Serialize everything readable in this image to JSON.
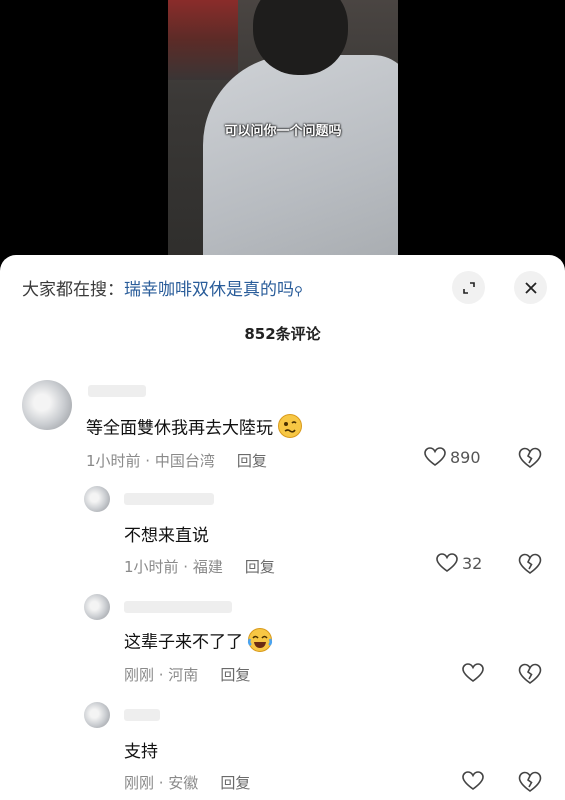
{
  "video": {
    "subtitle": "可以问你一个问题吗"
  },
  "search": {
    "prefix": "大家都在搜：",
    "query": "瑞幸咖啡双休是真的吗"
  },
  "comments_count": "852条评论",
  "comments": [
    {
      "text": "等全面雙休我再去大陸玩",
      "time_location": "1小时前 · 中国台湾",
      "reply": "回复",
      "likes": "890"
    },
    {
      "text": "不想来直说",
      "time_location": "1小时前 · 福建",
      "reply": "回复",
      "likes": "32"
    },
    {
      "text": "这辈子来不了了",
      "time_location": "刚刚 · 河南",
      "reply": "回复",
      "likes": ""
    },
    {
      "text": "支持",
      "time_location": "刚刚 · 安徽",
      "reply": "回复",
      "likes": ""
    }
  ],
  "icons": {
    "search": "magnifier-icon",
    "expand": "expand-icon",
    "close": "close-icon",
    "like": "heart-icon",
    "dislike": "broken-heart-icon"
  }
}
